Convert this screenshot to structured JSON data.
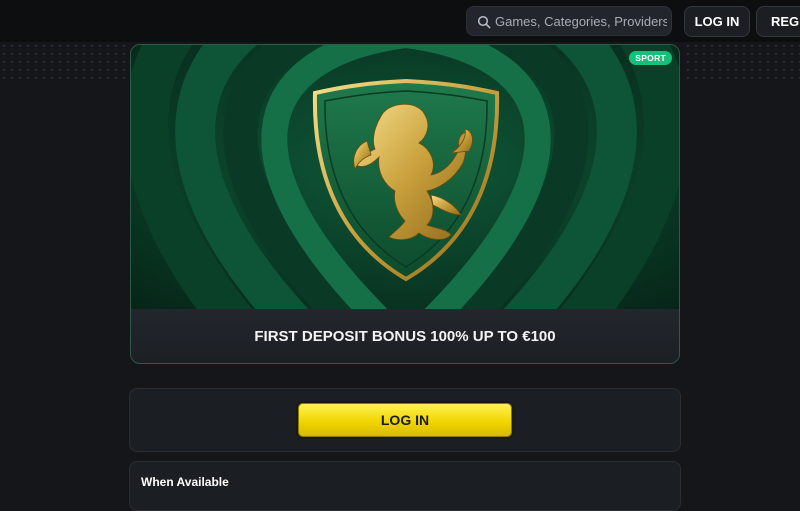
{
  "header": {
    "search_placeholder": "Games, Categories, Providers",
    "login_label": "LOG IN",
    "register_label": "REGIS"
  },
  "promo": {
    "badge": "SPORT",
    "title": "FIRST DEPOSIT BONUS 100% UP TO €100",
    "accent_color": "#16c07a"
  },
  "login_panel": {
    "button_label": "LOG IN",
    "button_color": "#f1d600"
  },
  "info_panel": {
    "title": "When Available"
  },
  "icons": [
    "search-icon",
    "lion-crest-icon"
  ]
}
